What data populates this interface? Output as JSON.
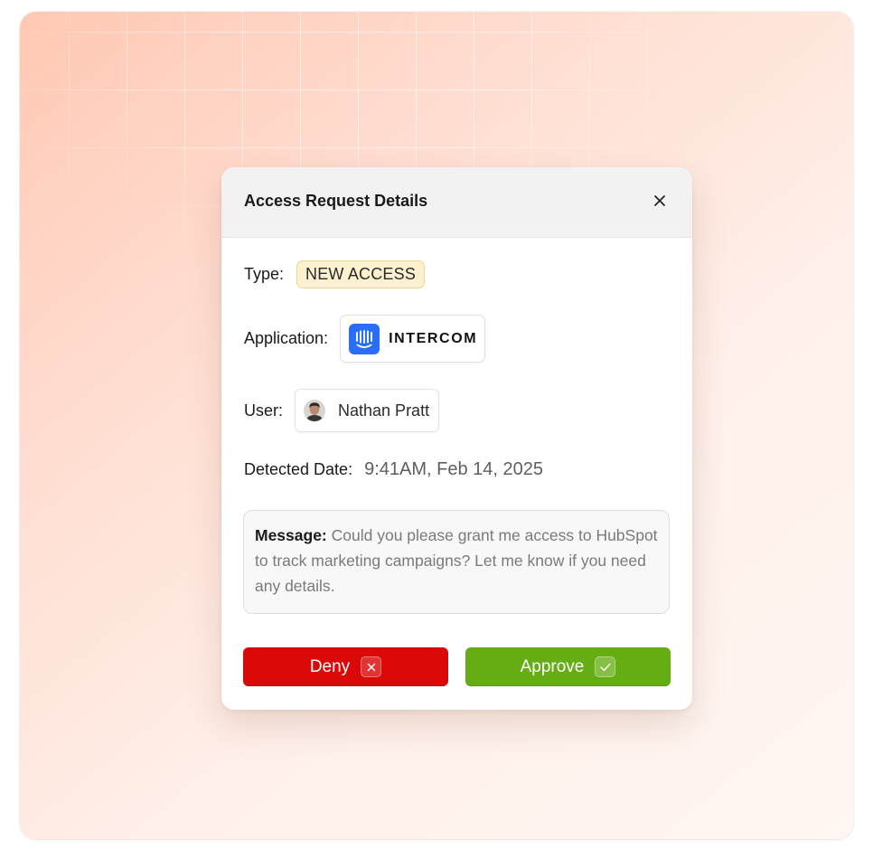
{
  "modal": {
    "title": "Access Request Details",
    "close_icon": "close-icon"
  },
  "fields": {
    "type_label": "Type:",
    "type_value": "NEW ACCESS",
    "application_label": "Application:",
    "application_name": "INTERCOM",
    "application_icon": "intercom-logo-icon",
    "user_label": "User:",
    "user_name": "Nathan Pratt",
    "detected_label": "Detected Date:",
    "detected_value": "9:41AM, Feb 14, 2025"
  },
  "message": {
    "label": "Message:",
    "text": "Could you please grant me access to HubSpot to track marketing campaigns? Let me know if you need any details."
  },
  "actions": {
    "deny_label": "Deny",
    "deny_icon": "x-icon",
    "approve_label": "Approve",
    "approve_icon": "check-icon"
  },
  "colors": {
    "deny": "#db0808",
    "approve": "#64ad12",
    "badge_bg": "#fdf1cf",
    "intercom_brand": "#286efa"
  }
}
